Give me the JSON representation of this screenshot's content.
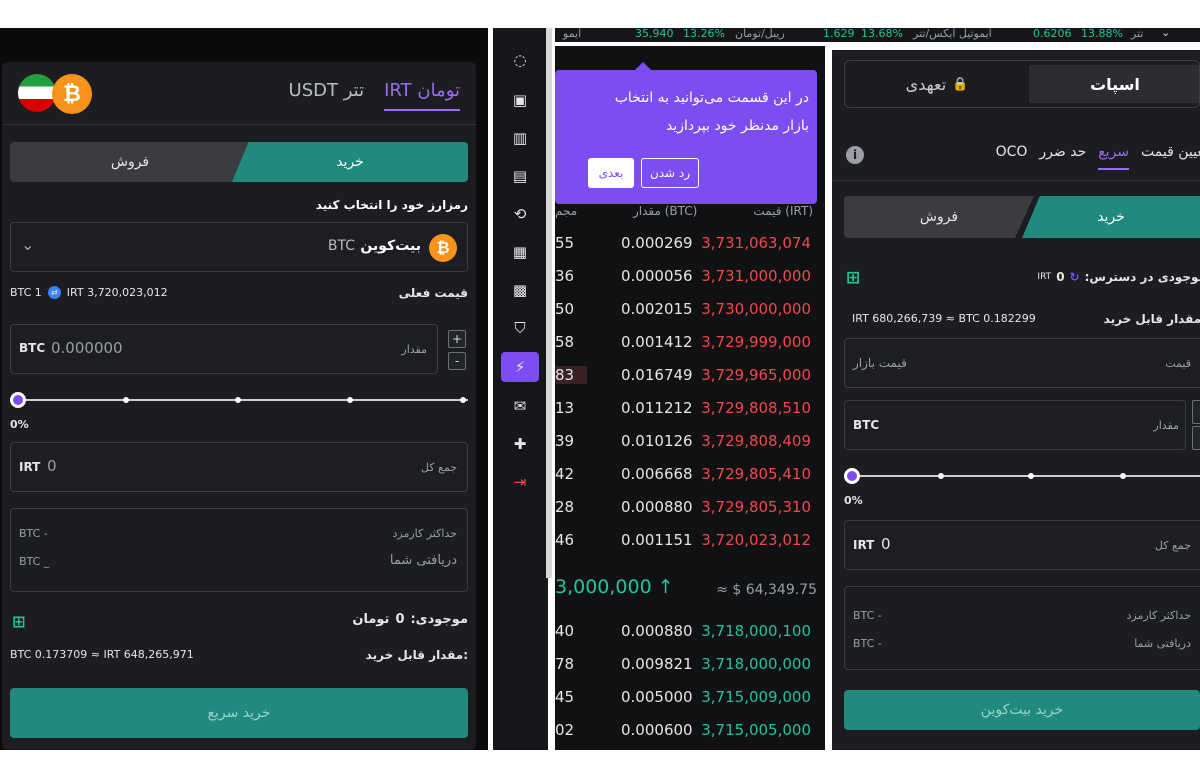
{
  "left_panel": {
    "tabs": [
      {
        "label": "تومان IRT",
        "active": true
      },
      {
        "label": "تتر USDT",
        "active": false
      }
    ],
    "buy_label": "خرید",
    "sell_label": "فروش",
    "select_crypto_label": "رمزارز خود را انتخاب کنید",
    "crypto_name": "بیت‌کوین",
    "crypto_code": "BTC",
    "current_price_label": "قیمت فعلی",
    "current_price_btc": "BTC 1",
    "current_price_irt": "IRT 3,720,023,012",
    "amount_label": "مقدار",
    "amount_unit": "BTC",
    "amount_value": "0.000000",
    "plus_label": "+",
    "minus_label": "-",
    "slider_percent": "0%",
    "total_label": "جمع کل",
    "total_unit": "IRT",
    "total_value": "0",
    "max_fee_label": "حداکثر کارمزد",
    "max_fee_value": "BTC  -",
    "receive_label": "دریافتی شما",
    "receive_value": "BTC  _",
    "balance_label": "موجودی:",
    "balance_value": "0",
    "balance_unit": "تومان",
    "buyable_label": "مقدار قابل خرید:",
    "buyable_value": "BTC 0.173709 ≈ IRT 648,265,971",
    "quick_buy_label": "خرید سریع"
  },
  "ticker": {
    "items": [
      "ایمو",
      "35,940",
      "13.26%",
      "ریبل/تومان",
      "1.629",
      "13.68%",
      "ایموتیل ایکس/تتر",
      "0.6206",
      "13.88%",
      "تتر"
    ]
  },
  "sidebar": {
    "icons": [
      "spinner-icon",
      "wallet-icon",
      "chart-icon",
      "clipboard-icon",
      "exchange-icon",
      "id-card-icon",
      "calendar-icon",
      "shield-icon",
      "bolt-icon",
      "mail-icon",
      "add-user-icon",
      "logout-icon"
    ]
  },
  "tooltip": {
    "text_line1": "در این قسمت می‌توانید به انتخاب",
    "text_line2": "بازار مدنظر خود بپردازید",
    "skip_label": "رد شدن",
    "next_label": "بعدی"
  },
  "orderbook": {
    "headers": {
      "price": "قیمت (IRT)",
      "amount": "مقدار (BTC)",
      "total": "مجم"
    },
    "asks": [
      {
        "total": "55",
        "amount": "0.000269",
        "price": "3,731,063,074"
      },
      {
        "total": "36",
        "amount": "0.000056",
        "price": "3,731,000,000"
      },
      {
        "total": "50",
        "amount": "0.002015",
        "price": "3,730,000,000"
      },
      {
        "total": "58",
        "amount": "0.001412",
        "price": "3,729,999,000"
      },
      {
        "total": "83",
        "amount": "0.016749",
        "price": "3,729,965,000"
      },
      {
        "total": "13",
        "amount": "0.011212",
        "price": "3,729,808,510"
      },
      {
        "total": "39",
        "amount": "0.010126",
        "price": "3,729,808,409"
      },
      {
        "total": "42",
        "amount": "0.006668",
        "price": "3,729,805,410"
      },
      {
        "total": "28",
        "amount": "0.000880",
        "price": "3,729,805,310"
      },
      {
        "total": "46",
        "amount": "0.001151",
        "price": "3,720,023,012"
      }
    ],
    "mid_price": "3,000,000 ↑",
    "mid_usd": "≈ $ 64,349.75",
    "bids": [
      {
        "total": "40",
        "amount": "0.000880",
        "price": "3,718,000,100"
      },
      {
        "total": "78",
        "amount": "0.009821",
        "price": "3,718,000,000"
      },
      {
        "total": "45",
        "amount": "0.005000",
        "price": "3,715,009,000"
      },
      {
        "total": "02",
        "amount": "0.000600",
        "price": "3,715,005,000"
      }
    ]
  },
  "right_panel": {
    "mode_tabs": [
      {
        "label": "اسپات",
        "active": true
      },
      {
        "label": "تعهدی",
        "active": false
      }
    ],
    "order_types": [
      "تعیین قیمت",
      "سریع",
      "حد ضرر",
      "OCO"
    ],
    "buy_label": "خرید",
    "sell_label": "فروش",
    "available_label": "موجودی در دسترس:",
    "available_value": "0",
    "available_unit": "IRT",
    "buyable_label": "مقدار قابل خرید:",
    "buyable_value": "IRT 680,266,739 ≈ BTC 0.182299",
    "price_label": "قیمت",
    "price_placeholder": "قیمت بازار",
    "amount_label": "مقدار",
    "amount_unit": "BTC",
    "slider_percent": "0%",
    "total_label": "جمع کل",
    "total_unit": "IRT",
    "total_value": "0",
    "max_fee_label": "حداکثر کارمزد",
    "max_fee_value": "BTC  -",
    "receive_label": "دریافتی شما",
    "receive_value": "BTC  -",
    "submit_label": "خرید بیت‌کوین"
  }
}
